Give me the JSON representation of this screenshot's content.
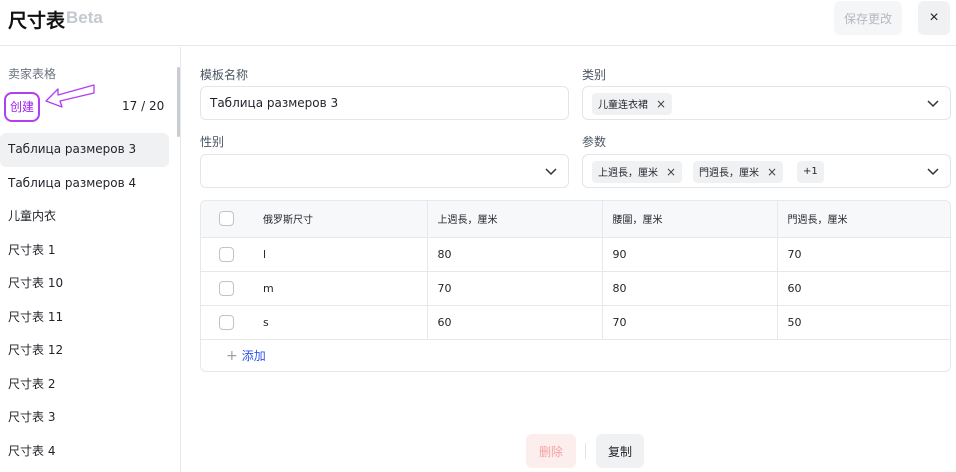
{
  "header": {
    "title": "尺寸表",
    "beta": "Beta",
    "save_label": "保存更改",
    "close_label": "×"
  },
  "sidebar": {
    "heading": "卖家表格",
    "create_label": "创建",
    "count": "17 / 20",
    "items": [
      {
        "label": "Таблица размеров 3",
        "active": true
      },
      {
        "label": "Таблица размеров 4"
      },
      {
        "label": "儿童内衣"
      },
      {
        "label": "尺寸表 1"
      },
      {
        "label": "尺寸表 10"
      },
      {
        "label": "尺寸表 11"
      },
      {
        "label": "尺寸表 12"
      },
      {
        "label": "尺寸表 2"
      },
      {
        "label": "尺寸表 3"
      },
      {
        "label": "尺寸表 4"
      }
    ]
  },
  "form": {
    "template_name_label": "模板名称",
    "template_name_value": "Таблица размеров 3",
    "category_label": "类别",
    "category_tags": [
      "儿童连衣裙"
    ],
    "gender_label": "性别",
    "gender_value": "",
    "params_label": "参数",
    "param_tags": [
      "上週長，厘米",
      "門週長，厘米"
    ],
    "param_more": "+1"
  },
  "table": {
    "headers": [
      "俄罗斯尺寸",
      "上週長，厘米",
      "腰圍，厘米",
      "門週長，厘米"
    ],
    "rows": [
      [
        "l",
        "80",
        "90",
        "70"
      ],
      [
        "m",
        "70",
        "80",
        "60"
      ],
      [
        "s",
        "60",
        "70",
        "50"
      ]
    ],
    "add_label": "添加"
  },
  "footer": {
    "delete_label": "删除",
    "copy_label": "复制"
  },
  "colors": {
    "annotation": "#b33df2",
    "add_link": "#2f54eb",
    "delete_text": "#f5a3a3"
  },
  "icons": [
    "close-icon",
    "chevron-down-icon",
    "tag-remove-icon",
    "plus-icon",
    "checkbox-icon",
    "annotation-arrow"
  ]
}
